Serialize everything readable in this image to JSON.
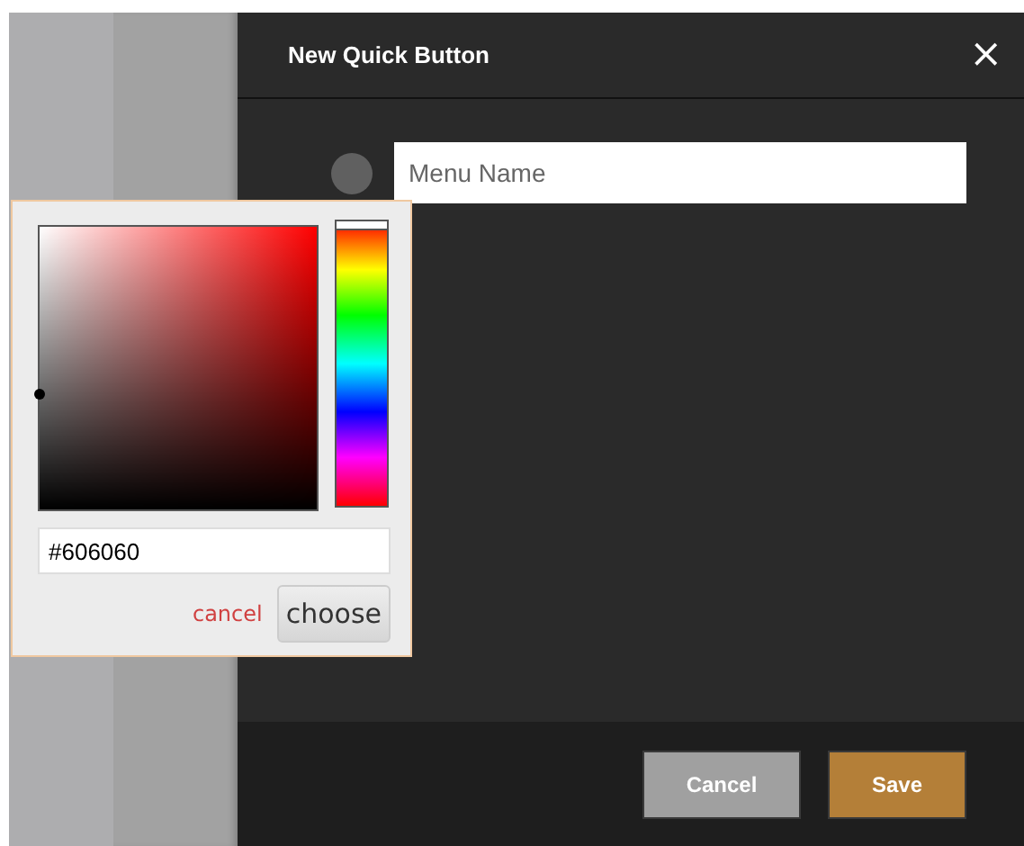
{
  "dialog": {
    "title": "New Quick Button",
    "close": "×"
  },
  "menu": {
    "color": "#606060",
    "placeholder": "Menu Name"
  },
  "color_picker": {
    "hue": {
      "level": 0
    },
    "hex_value": "#606060",
    "cancel": "cancel",
    "choose": "choose"
  },
  "buttons": [
    {
      "label": "Cancel",
      "kind": "secondary"
    },
    {
      "label": "Save",
      "kind": "primary"
    }
  ]
}
